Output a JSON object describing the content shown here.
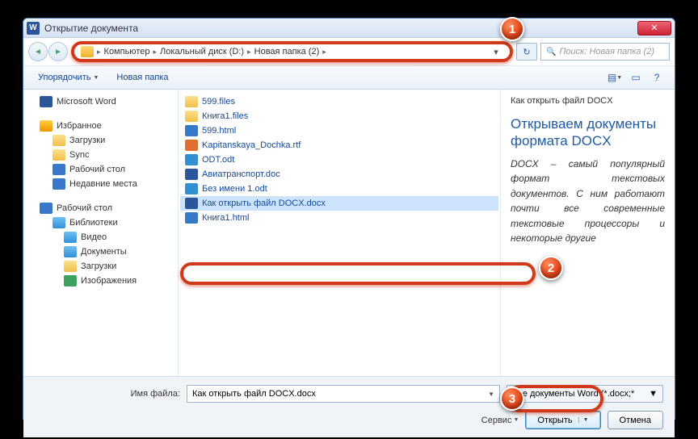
{
  "window": {
    "title": "Открытие документа"
  },
  "breadcrumb": {
    "items": [
      "Компьютер",
      "Локальный диск (D:)",
      "Новая папка (2)"
    ]
  },
  "search": {
    "placeholder": "Поиск: Новая папка (2)"
  },
  "toolbar": {
    "organize": "Упорядочить",
    "newfolder": "Новая папка"
  },
  "sidebar": {
    "word": "Microsoft Word",
    "fav": "Избранное",
    "downloads": "Загрузки",
    "sync": "Sync",
    "desktop": "Рабочий стол",
    "recent": "Недавние места",
    "desktop2": "Рабочий стол",
    "libraries": "Библиотеки",
    "video": "Видео",
    "documents": "Документы",
    "downloads2": "Загрузки",
    "images": "Изображения"
  },
  "files": [
    {
      "name": "599.files",
      "icon": "f-fold"
    },
    {
      "name": "Книга1.files",
      "icon": "f-fold"
    },
    {
      "name": "599.html",
      "icon": "f-html"
    },
    {
      "name": "Kapitanskaya_Dochka.rtf",
      "icon": "f-rtf"
    },
    {
      "name": "ODT.odt",
      "icon": "f-odt"
    },
    {
      "name": "Авиатранспорт.doc",
      "icon": "f-doc"
    },
    {
      "name": "Без имени 1.odt",
      "icon": "f-odt"
    },
    {
      "name": "Как открыть файл DOCX.docx",
      "icon": "f-doc",
      "selected": true
    },
    {
      "name": "Книга1.html",
      "icon": "f-html"
    }
  ],
  "preview": {
    "filename": "Как открыть файл DOCX",
    "heading": "Открываем документы формата DOCX",
    "body": "DOCX – самый популярный формат текстовых документов. С ним работают почти все современные текстовые процессоры и некоторые другие"
  },
  "footer": {
    "label": "Имя файла:",
    "filename": "Как открыть файл DOCX.docx",
    "filetype": "Все документы Word (*.docx;*",
    "tools": "Сервис",
    "open": "Открыть",
    "cancel": "Отмена"
  },
  "callouts": {
    "c1": "1",
    "c2": "2",
    "c3": "3"
  }
}
